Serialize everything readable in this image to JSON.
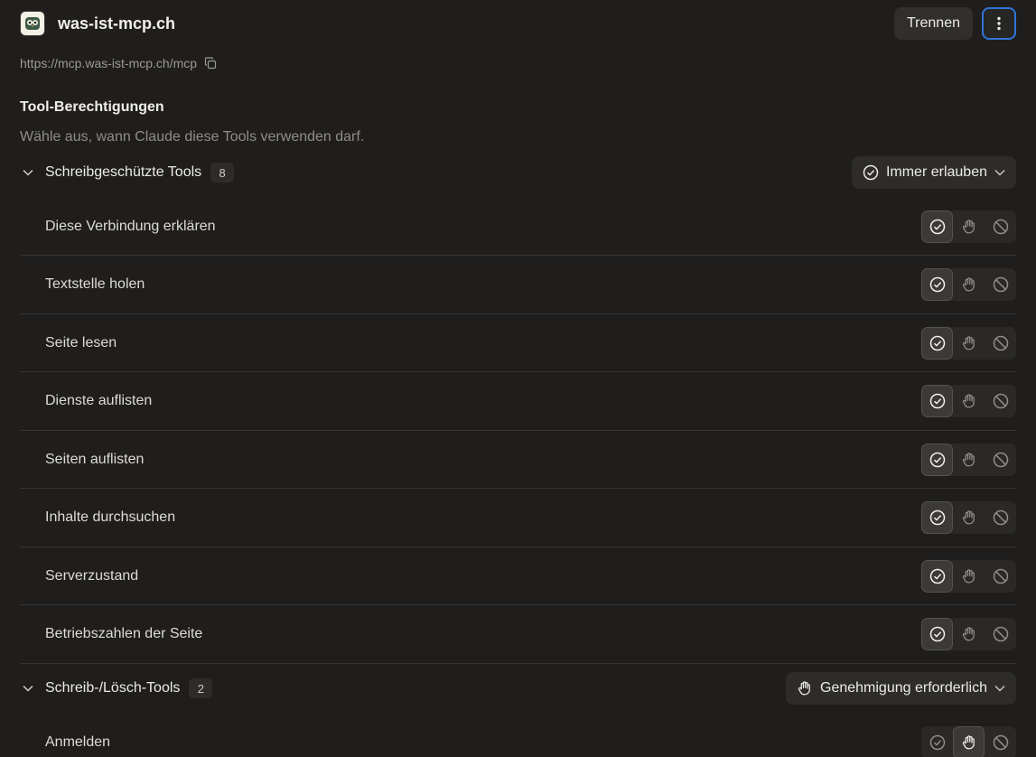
{
  "header": {
    "server_name": "was-ist-mcp.ch",
    "disconnect_label": "Trennen",
    "url": "https://mcp.was-ist-mcp.ch/mcp"
  },
  "permissions": {
    "title": "Tool-Berechtigungen",
    "subtitle": "Wähle aus, wann Claude diese Tools verwenden darf."
  },
  "groups": [
    {
      "label": "Schreibgeschützte Tools",
      "count": "8",
      "policy_label": "Immer erlauben",
      "policy_icon": "check-circle-icon",
      "tools": [
        {
          "name": "Diese Verbindung erklären",
          "selected": "allow"
        },
        {
          "name": "Textstelle holen",
          "selected": "allow"
        },
        {
          "name": "Seite lesen",
          "selected": "allow"
        },
        {
          "name": "Dienste auflisten",
          "selected": "allow"
        },
        {
          "name": "Seiten auflisten",
          "selected": "allow"
        },
        {
          "name": "Inhalte durchsuchen",
          "selected": "allow"
        },
        {
          "name": "Serverzustand",
          "selected": "allow"
        },
        {
          "name": "Betriebszahlen der Seite",
          "selected": "allow"
        }
      ]
    },
    {
      "label": "Schreib-/Lösch-Tools",
      "count": "2",
      "policy_label": "Genehmigung erforderlich",
      "policy_icon": "hand-icon",
      "tools": [
        {
          "name": "Anmelden",
          "selected": "ask"
        }
      ]
    }
  ],
  "colors": {
    "background": "#1f1e1d",
    "accent_focus": "#2f74d8"
  }
}
